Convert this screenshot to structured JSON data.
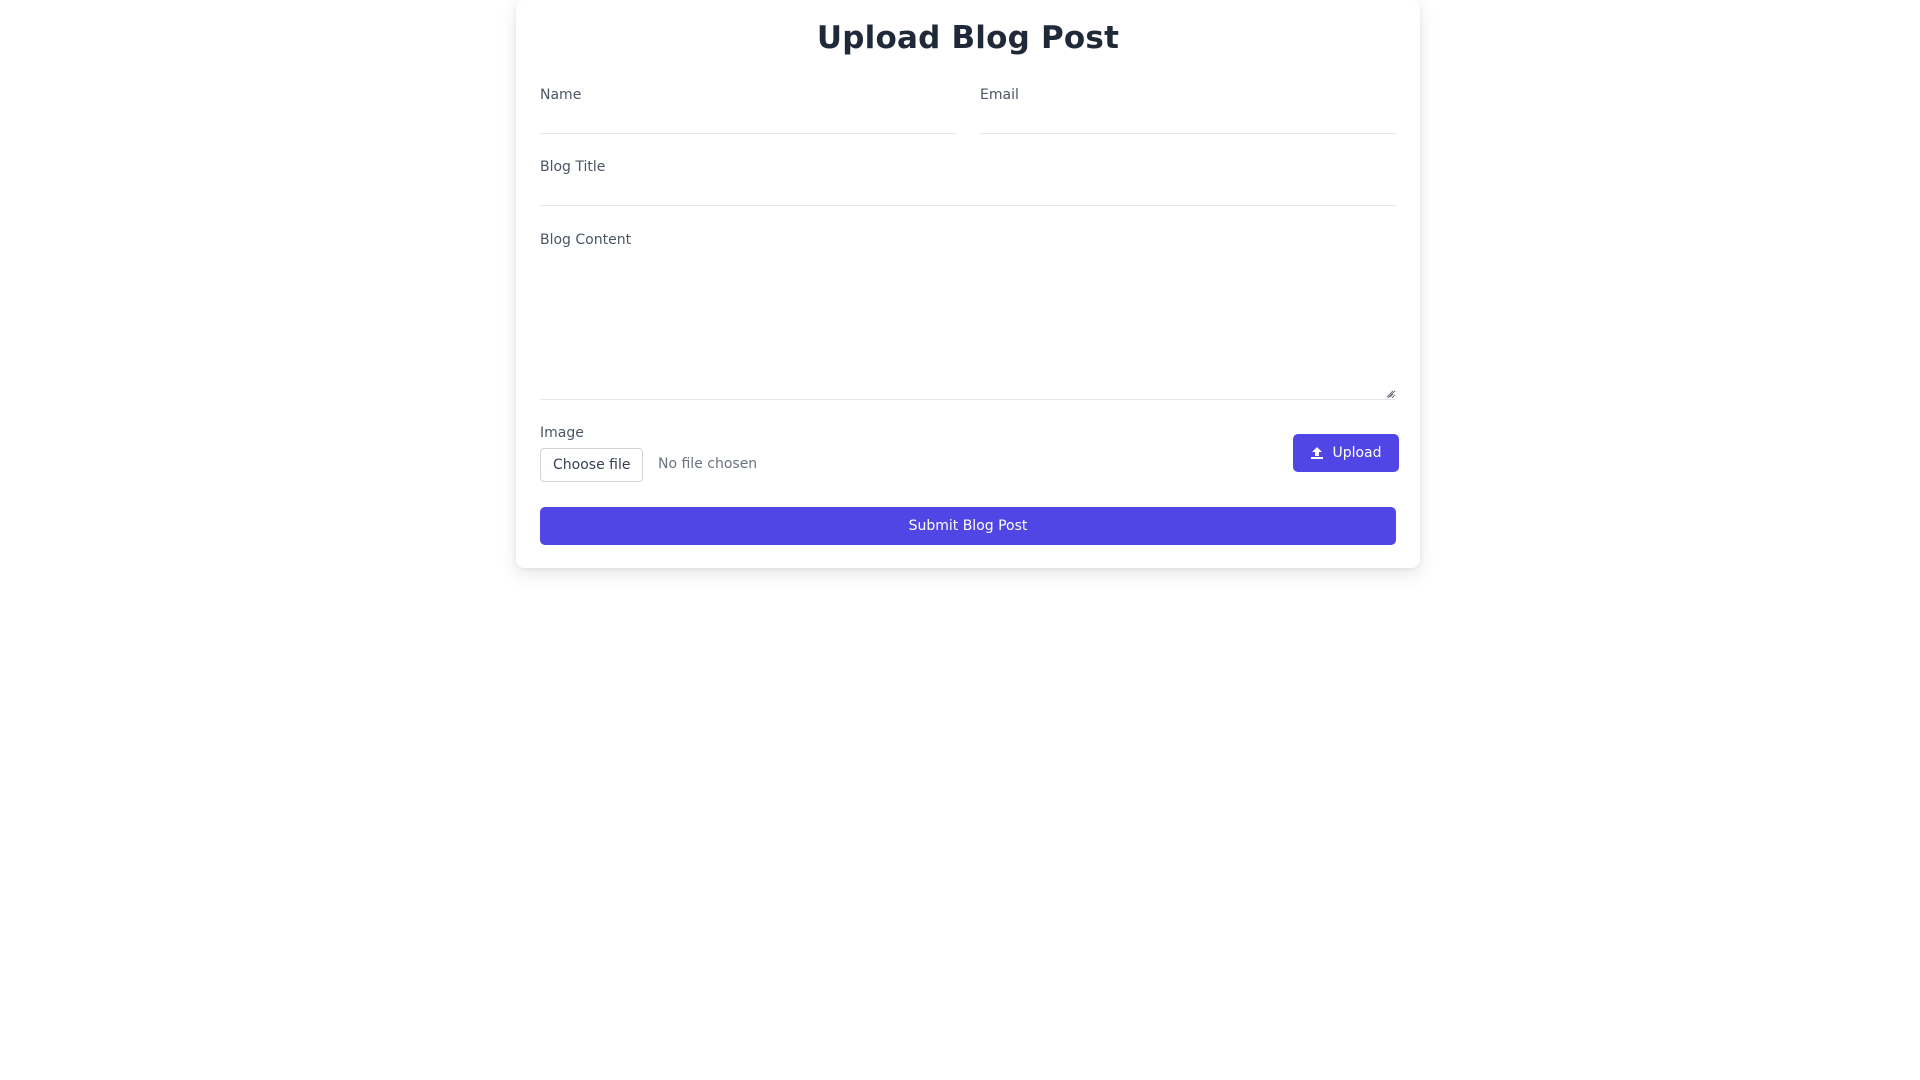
{
  "page": {
    "title": "Upload Blog Post"
  },
  "form": {
    "name_label": "Name",
    "name_value": "",
    "email_label": "Email",
    "email_value": "",
    "blog_title_label": "Blog Title",
    "blog_title_value": "",
    "blog_content_label": "Blog Content",
    "blog_content_value": "",
    "image_label": "Image",
    "choose_file_label": "Choose file",
    "file_status": "No file chosen",
    "upload_label": "Upload",
    "submit_label": "Submit Blog Post"
  },
  "icons": {
    "upload": "upload-icon"
  },
  "colors": {
    "accent": "#4f46e5",
    "title": "#1f2937",
    "label": "#4b5563",
    "border": "#e5e7eb"
  }
}
